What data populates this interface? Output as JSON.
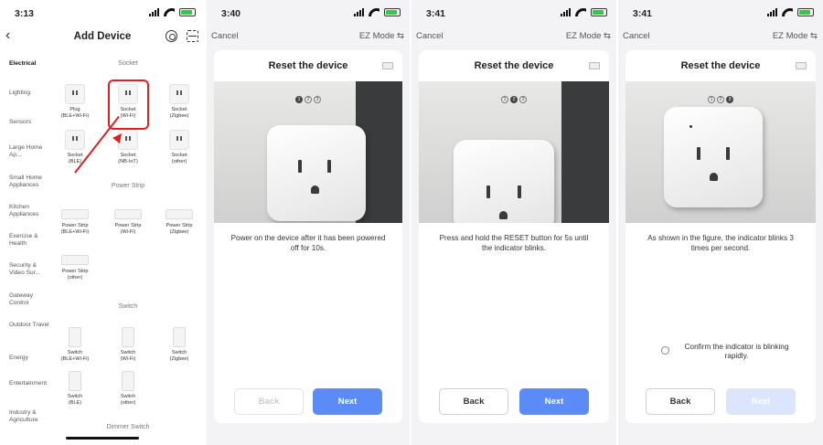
{
  "screens": [
    {
      "status_time": "3:13",
      "title": "Add Device",
      "categories": [
        "Electrical",
        "Lighting",
        "Sensors",
        "Large Home Ap...",
        "Small Home Appliances",
        "Kitchen Appliances",
        "Exercise & Health",
        "Security & Video Sur...",
        "Gateway Control",
        "Outdoor Travel",
        "Energy",
        "Entertainment",
        "Industry & Agriculture"
      ],
      "sections": {
        "socket": "Socket",
        "power_strip": "Power Strip",
        "switch": "Switch",
        "dimmer": "Dimmer Switch"
      },
      "sockets": [
        {
          "label": "Plug\n(BLE+Wi-Fi)"
        },
        {
          "label": "Socket\n(Wi-Fi)"
        },
        {
          "label": "Socket\n(Zigbee)"
        },
        {
          "label": "Socket\n(BLE)"
        },
        {
          "label": "Socket\n(NB-IoT)"
        },
        {
          "label": "Socket\n(other)"
        }
      ],
      "power_strips": [
        {
          "label": "Power Strip\n(BLE+Wi-Fi)"
        },
        {
          "label": "Power Strip\n(Wi-Fi)"
        },
        {
          "label": "Power Strip\n(Zigbee)"
        },
        {
          "label": "Power Strip\n(other)"
        }
      ],
      "switches": [
        {
          "label": "Switch\n(BLE+Wi-Fi)"
        },
        {
          "label": "Switch\n(Wi-Fi)"
        },
        {
          "label": "Switch\n(Zigbee)"
        },
        {
          "label": "Switch\n(BLE)"
        },
        {
          "label": "Switch\n(other)"
        }
      ],
      "highlight_color": "#e02020"
    },
    {
      "status_time": "3:40",
      "cancel": "Cancel",
      "mode": "EZ Mode ⇆",
      "card_title": "Reset the device",
      "step": 1,
      "steps": [
        "1",
        "2",
        "3"
      ],
      "description": "Power on the device after it has been powered off for 10s.",
      "back": "Back",
      "next": "Next",
      "back_disabled": true,
      "next_disabled": false
    },
    {
      "status_time": "3:41",
      "cancel": "Cancel",
      "mode": "EZ Mode ⇆",
      "card_title": "Reset the device",
      "step": 2,
      "steps": [
        "1",
        "2",
        "3"
      ],
      "description": "Press and hold the RESET button for 5s until the indicator blinks.",
      "back": "Back",
      "next": "Next",
      "back_disabled": false,
      "next_disabled": false
    },
    {
      "status_time": "3:41",
      "cancel": "Cancel",
      "mode": "EZ Mode ⇆",
      "card_title": "Reset the device",
      "step": 3,
      "steps": [
        "1",
        "2",
        "3"
      ],
      "description": "As shown in the figure, the indicator blinks 3 times per second.",
      "confirm": "Confirm the indicator is blinking rapidly.",
      "back": "Back",
      "next": "Next",
      "back_disabled": false,
      "next_disabled": true
    }
  ],
  "accent": "#5a8bf6"
}
